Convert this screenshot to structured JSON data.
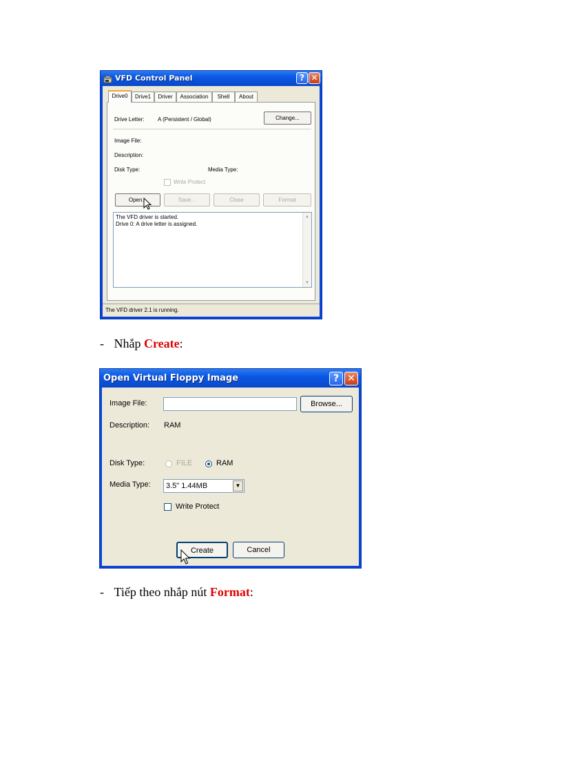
{
  "panel1": {
    "title": "VFD Control Panel",
    "tabs": [
      "Drive0",
      "Drive1",
      "Driver",
      "Association",
      "Shell",
      "About"
    ],
    "drive_letter_label": "Drive Letter:",
    "drive_letter_value": "A (Persistent / Global)",
    "change_button": "Change...",
    "image_file_label": "Image File:",
    "description_label": "Description:",
    "disk_type_label": "Disk Type:",
    "media_type_label": "Media Type:",
    "write_protect_label": "Write Protect",
    "buttons": {
      "open": "Open...",
      "save": "Save...",
      "close": "Close",
      "format": "Format"
    },
    "log_lines": [
      "The VFD driver is started.",
      "Drive 0: A drive letter is assigned."
    ],
    "status": "The VFD driver 2.1 is running."
  },
  "instruction1": {
    "bullet": "-",
    "text": "Nhắp ",
    "highlight": "Create",
    "suffix": ":"
  },
  "panel2": {
    "title": "Open Virtual Floppy Image",
    "image_file_label": "Image File:",
    "image_file_value": "",
    "browse_button": "Browse...",
    "description_label": "Description:",
    "description_value": "RAM",
    "disk_type_label": "Disk Type:",
    "disk_type_options": [
      "FILE",
      "RAM"
    ],
    "disk_type_selected": "RAM",
    "media_type_label": "Media Type:",
    "media_type_value": "3.5\" 1.44MB",
    "write_protect_label": "Write Protect",
    "create_button": "Create",
    "cancel_button": "Cancel"
  },
  "instruction2": {
    "bullet": "-",
    "text": "Tiếp theo nhắp nút ",
    "highlight": "Format",
    "suffix": ":"
  },
  "colors": {
    "highlight": "#e00000",
    "titlebar": "#0a58e4",
    "dialog_bg": "#ece9d8"
  },
  "icons": [
    "vfd-app-icon",
    "help-icon",
    "close-icon",
    "dropdown-arrow-icon",
    "mouse-cursor-icon"
  ]
}
